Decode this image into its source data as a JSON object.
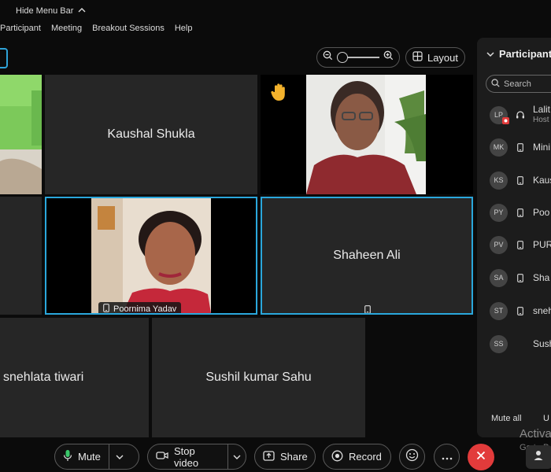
{
  "topbar": {
    "hide_menu_label": "Hide Menu Bar"
  },
  "menu": {
    "items": [
      "Participant",
      "Meeting",
      "Breakout Sessions",
      "Help"
    ]
  },
  "toolbar": {
    "layout_label": "Layout"
  },
  "tiles": {
    "kaushal": "Kaushal Shukla",
    "poornima_tag": "Poornima Yadav",
    "shaheen": "Shaheen Ali",
    "snehlata": "snehlata tiwari",
    "sushil": "Sushil kumar Sahu"
  },
  "panel": {
    "title": "Participant",
    "search_placeholder": "Search",
    "participants": [
      {
        "initials": "LP",
        "name": "Lalit",
        "role": "Host"
      },
      {
        "initials": "MK",
        "name": "Mini"
      },
      {
        "initials": "KS",
        "name": "Kaus"
      },
      {
        "initials": "PY",
        "name": "Poo"
      },
      {
        "initials": "PV",
        "name": "PUR"
      },
      {
        "initials": "SA",
        "name": "Sha"
      },
      {
        "initials": "ST",
        "name": "sneh"
      },
      {
        "initials": "SS",
        "name": "Sush"
      }
    ],
    "mute_all": "Mute all",
    "unmute_all": "U"
  },
  "watermark": {
    "line1": "Activa",
    "line2": "Go to P"
  },
  "controls": {
    "mute": "Mute",
    "stop_video": "Stop video",
    "share": "Share",
    "record": "Record"
  },
  "colors": {
    "accent": "#2aa7dc",
    "end_call": "#e23b3b",
    "tile": "#262626"
  }
}
